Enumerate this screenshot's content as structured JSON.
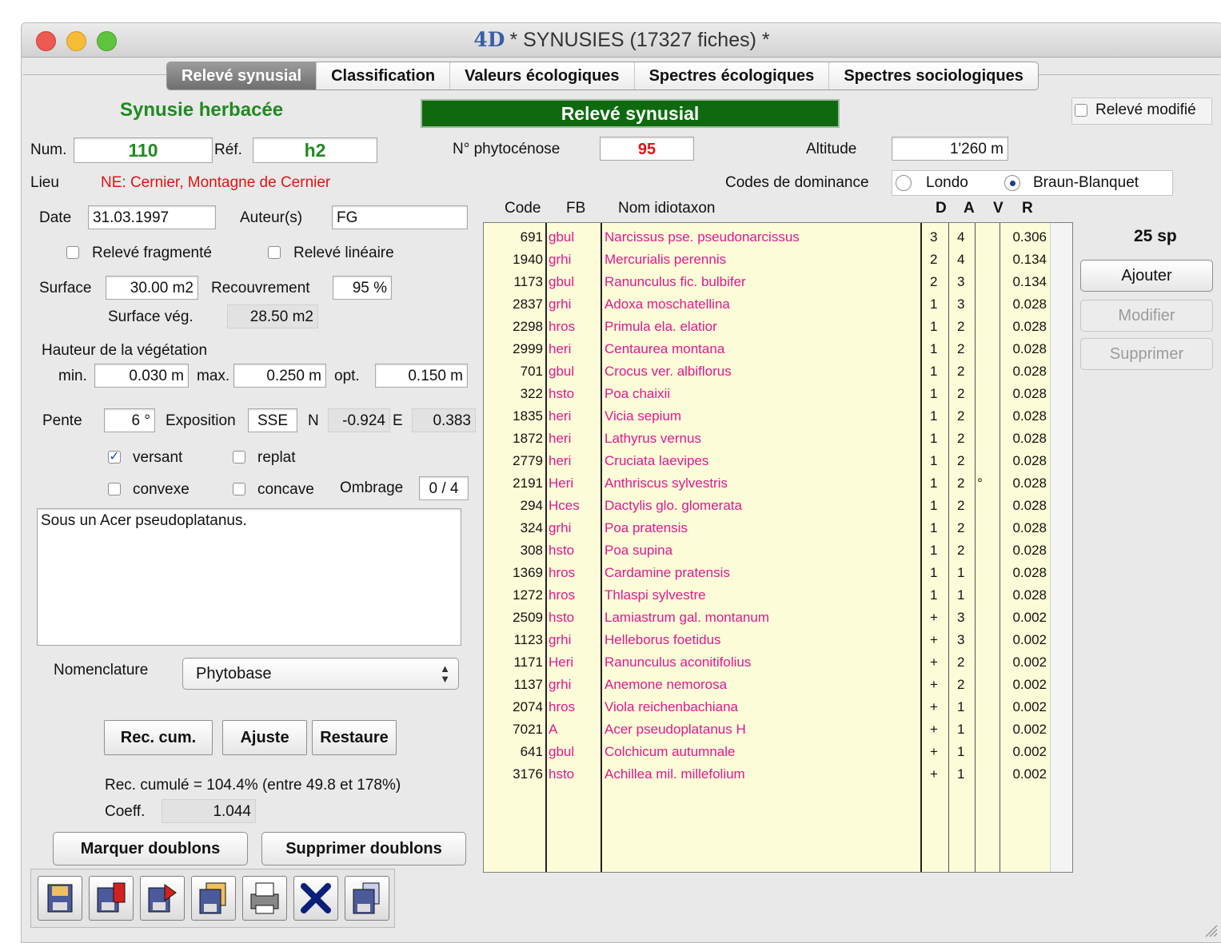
{
  "window": {
    "title": "* SYNUSIES (17327 fiches) *",
    "logo": "4D"
  },
  "tabs": [
    "Relevé synusial",
    "Classification",
    "Valeurs écologiques",
    "Spectres écologiques",
    "Spectres sociologiques"
  ],
  "header": {
    "type_label": "Synusie herbacée",
    "section_title": "Relevé synusial",
    "modified_label": "Relevé modifié"
  },
  "left": {
    "num_label": "Num.",
    "num_value": "110",
    "ref_label": "Réf.",
    "ref_value": "h2",
    "lieu_label": "Lieu",
    "lieu_value": "NE: Cernier, Montagne de Cernier",
    "date_label": "Date",
    "date_value": "31.03.1997",
    "auteur_label": "Auteur(s)",
    "auteur_value": "FG",
    "fragmente_label": "Relevé fragmenté",
    "lineaire_label": "Relevé linéaire",
    "surface_label": "Surface",
    "surface_value": "30.00 m2",
    "recouvrement_label": "Recouvrement",
    "recouvrement_value": "95 %",
    "surface_veg_label": "Surface vég.",
    "surface_veg_value": "28.50 m2",
    "hauteur_label": "Hauteur de la végétation",
    "min_label": "min.",
    "min_value": "0.030 m",
    "max_label": "max.",
    "max_value": "0.250 m",
    "opt_label": "opt.",
    "opt_value": "0.150 m",
    "pente_label": "Pente",
    "pente_value": "6 °",
    "exposition_label": "Exposition",
    "exposition_value": "SSE",
    "n_label": "N",
    "n_value": "-0.924",
    "e_label": "E",
    "e_value": "0.383",
    "versant_label": "versant",
    "replat_label": "replat",
    "convexe_label": "convexe",
    "concave_label": "concave",
    "ombrage_label": "Ombrage",
    "ombrage_value": "0 / 4",
    "notes": "Sous un Acer pseudoplatanus.",
    "nomenclature_label": "Nomenclature",
    "nomenclature_value": "Phytobase",
    "btn_rec_cum": "Rec. cum.",
    "btn_ajuste": "Ajuste",
    "btn_restaure": "Restaure",
    "rec_cumule_text": "Rec. cumulé = 104.4% (entre 49.8 et 178%)",
    "coeff_label": "Coeff.",
    "coeff_value": "1.044",
    "btn_marquer": "Marquer doublons",
    "btn_supprimer_doublons": "Supprimer doublons"
  },
  "middle": {
    "phyto_label": "N° phytocénose",
    "phyto_value": "95",
    "altitude_label": "Altitude",
    "altitude_value": "1'260 m",
    "codes_label": "Codes de dominance",
    "londo_label": "Londo",
    "braun_label": "Braun-Blanquet"
  },
  "table": {
    "headers": {
      "code": "Code",
      "fb": "FB",
      "nom": "Nom idiotaxon",
      "d": "D",
      "a": "A",
      "v": "V",
      "r": "R"
    },
    "rows": [
      {
        "code": "691",
        "fb": "gbul",
        "nom": "Narcissus pse. pseudonarcissus",
        "d": "3",
        "a": "4",
        "v": "",
        "r": "0.306"
      },
      {
        "code": "1940",
        "fb": "grhi",
        "nom": "Mercurialis perennis",
        "d": "2",
        "a": "4",
        "v": "",
        "r": "0.134"
      },
      {
        "code": "1173",
        "fb": "gbul",
        "nom": "Ranunculus fic. bulbifer",
        "d": "2",
        "a": "3",
        "v": "",
        "r": "0.134"
      },
      {
        "code": "2837",
        "fb": "grhi",
        "nom": "Adoxa moschatellina",
        "d": "1",
        "a": "3",
        "v": "",
        "r": "0.028"
      },
      {
        "code": "2298",
        "fb": "hros",
        "nom": "Primula ela. elatior",
        "d": "1",
        "a": "2",
        "v": "",
        "r": "0.028"
      },
      {
        "code": "2999",
        "fb": "heri",
        "nom": "Centaurea montana",
        "d": "1",
        "a": "2",
        "v": "",
        "r": "0.028"
      },
      {
        "code": "701",
        "fb": "gbul",
        "nom": "Crocus ver. albiflorus",
        "d": "1",
        "a": "2",
        "v": "",
        "r": "0.028"
      },
      {
        "code": "322",
        "fb": "hsto",
        "nom": "Poa chaixii",
        "d": "1",
        "a": "2",
        "v": "",
        "r": "0.028"
      },
      {
        "code": "1835",
        "fb": "heri",
        "nom": "Vicia sepium",
        "d": "1",
        "a": "2",
        "v": "",
        "r": "0.028"
      },
      {
        "code": "1872",
        "fb": "heri",
        "nom": "Lathyrus vernus",
        "d": "1",
        "a": "2",
        "v": "",
        "r": "0.028"
      },
      {
        "code": "2779",
        "fb": "heri",
        "nom": "Cruciata laevipes",
        "d": "1",
        "a": "2",
        "v": "",
        "r": "0.028"
      },
      {
        "code": "2191",
        "fb": "Heri",
        "nom": "Anthriscus sylvestris",
        "d": "1",
        "a": "2",
        "v": "°",
        "r": "0.028"
      },
      {
        "code": "294",
        "fb": "Hces",
        "nom": "Dactylis glo. glomerata",
        "d": "1",
        "a": "2",
        "v": "",
        "r": "0.028"
      },
      {
        "code": "324",
        "fb": "grhi",
        "nom": "Poa pratensis",
        "d": "1",
        "a": "2",
        "v": "",
        "r": "0.028"
      },
      {
        "code": "308",
        "fb": "hsto",
        "nom": "Poa supina",
        "d": "1",
        "a": "2",
        "v": "",
        "r": "0.028"
      },
      {
        "code": "1369",
        "fb": "hros",
        "nom": "Cardamine pratensis",
        "d": "1",
        "a": "1",
        "v": "",
        "r": "0.028"
      },
      {
        "code": "1272",
        "fb": "hros",
        "nom": "Thlaspi sylvestre",
        "d": "1",
        "a": "1",
        "v": "",
        "r": "0.028"
      },
      {
        "code": "2509",
        "fb": "hsto",
        "nom": "Lamiastrum gal. montanum",
        "d": "+",
        "a": "3",
        "v": "",
        "r": "0.002"
      },
      {
        "code": "1123",
        "fb": "grhi",
        "nom": "Helleborus foetidus",
        "d": "+",
        "a": "3",
        "v": "",
        "r": "0.002"
      },
      {
        "code": "1171",
        "fb": "Heri",
        "nom": "Ranunculus aconitifolius",
        "d": "+",
        "a": "2",
        "v": "",
        "r": "0.002"
      },
      {
        "code": "1137",
        "fb": "grhi",
        "nom": "Anemone nemorosa",
        "d": "+",
        "a": "2",
        "v": "",
        "r": "0.002"
      },
      {
        "code": "2074",
        "fb": "hros",
        "nom": "Viola reichenbachiana",
        "d": "+",
        "a": "1",
        "v": "",
        "r": "0.002"
      },
      {
        "code": "7021",
        "fb": "A",
        "nom": "Acer pseudoplatanus H",
        "d": "+",
        "a": "1",
        "v": "",
        "r": "0.002"
      },
      {
        "code": "641",
        "fb": "gbul",
        "nom": "Colchicum autumnale",
        "d": "+",
        "a": "1",
        "v": "",
        "r": "0.002"
      },
      {
        "code": "3176",
        "fb": "hsto",
        "nom": "Achillea mil. millefolium",
        "d": "+",
        "a": "1",
        "v": "",
        "r": "0.002"
      }
    ]
  },
  "right": {
    "count_label": "25 sp",
    "btn_ajouter": "Ajouter",
    "btn_modifier": "Modifier",
    "btn_supprimer": "Supprimer"
  },
  "toolbar_icons": [
    "save-icon",
    "save-red-icon",
    "export-red-icon",
    "copy-icon",
    "print-icon",
    "delete-icon",
    "duplicate-icon"
  ],
  "colors": {
    "accent_green": "#1f8a1f",
    "header_bar": "#0f6a0f",
    "red_text": "#e01414",
    "species_pink": "#e0188f",
    "grid_bg": "#fdfcd8"
  }
}
